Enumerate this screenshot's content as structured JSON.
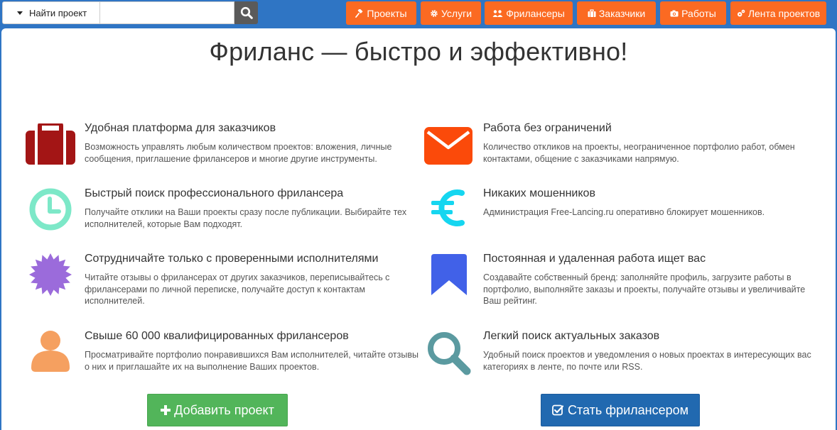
{
  "search": {
    "dropdown_label": "Найти проект",
    "placeholder": ""
  },
  "nav": {
    "items": [
      {
        "label": "Проекты",
        "icon": "gavel-icon"
      },
      {
        "label": "Услуги",
        "icon": "gear-icon"
      },
      {
        "label": "Фрилансеры",
        "icon": "users-icon"
      },
      {
        "label": "Заказчики",
        "icon": "briefcase-icon"
      },
      {
        "label": "Работы",
        "icon": "camera-icon"
      },
      {
        "label": "Лента проектов",
        "icon": "gears-icon"
      }
    ]
  },
  "main": {
    "title": "Фриланс — быстро и эффективно!",
    "features": [
      {
        "title": "Удобная платформа для заказчиков",
        "text": "Возможность управлять любым количеством проектов: вложения, личные сообщения, приглашение фрилансеров и многие другие инструменты.",
        "icon": "briefcase-icon",
        "color": "#a31515"
      },
      {
        "title": "Работа без ограничений",
        "text": "Количество откликов на проекты, неограниченное портфолио работ, обмен контактами, общение с заказчиками напрямую.",
        "icon": "envelope-icon",
        "color": "#fb4a0a"
      },
      {
        "title": "Быстрый поиск профессионального фрилансера",
        "text": "Получайте отклики на Ваши проекты сразу после публикации. Выбирайте тех исполнителей, которые Вам подходят.",
        "icon": "clock-icon",
        "color": "#7de8c8"
      },
      {
        "title": "Никаких мошенников",
        "text": "Администрация Free-Lancing.ru оперативно блокирует мошенников.",
        "icon": "euro-icon",
        "color": "#15d6f0"
      },
      {
        "title": "Сотрудничайте только с проверенными исполнителями",
        "text": "Читайте отзывы о фрилансерах от других заказчиков, переписывайтесь с фрилансерами по личной переписке, получайте доступ к контактам исполнителей.",
        "icon": "certificate-icon",
        "color": "#9b6bdb"
      },
      {
        "title": "Постоянная и удаленная работа ищет вас",
        "text": "Создавайте собственный бренд: заполняйте профиль, загрузите работы в портфолио, выполняйте заказы и проекты, получайте отзывы и увеличивайте Ваш рейтинг.",
        "icon": "bookmark-icon",
        "color": "#4161e8"
      },
      {
        "title": "Свыше 60 000 квалифицированных фрилансеров",
        "text": "Просматривайте портфолио понравившихся Вам исполнителей, читайте отзывы о них и приглашайте их на выполнение Ваших проектов.",
        "icon": "user-icon",
        "color": "#f5a060"
      },
      {
        "title": "Легкий поиск актуальных заказов",
        "text": "Удобный поиск проектов и уведомления о новых проектах в интересующих вас категориях в ленте, по почте или RSS.",
        "icon": "search-icon",
        "color": "#5b9aa0"
      }
    ],
    "add_project_label": "Добавить проект",
    "become_freelancer_label": "Стать фрилансером"
  },
  "colors": {
    "nav_orange": "#fb6a22",
    "header_blue": "#2f75c4",
    "green_button": "#52b55a",
    "blue_button": "#2169b0"
  }
}
